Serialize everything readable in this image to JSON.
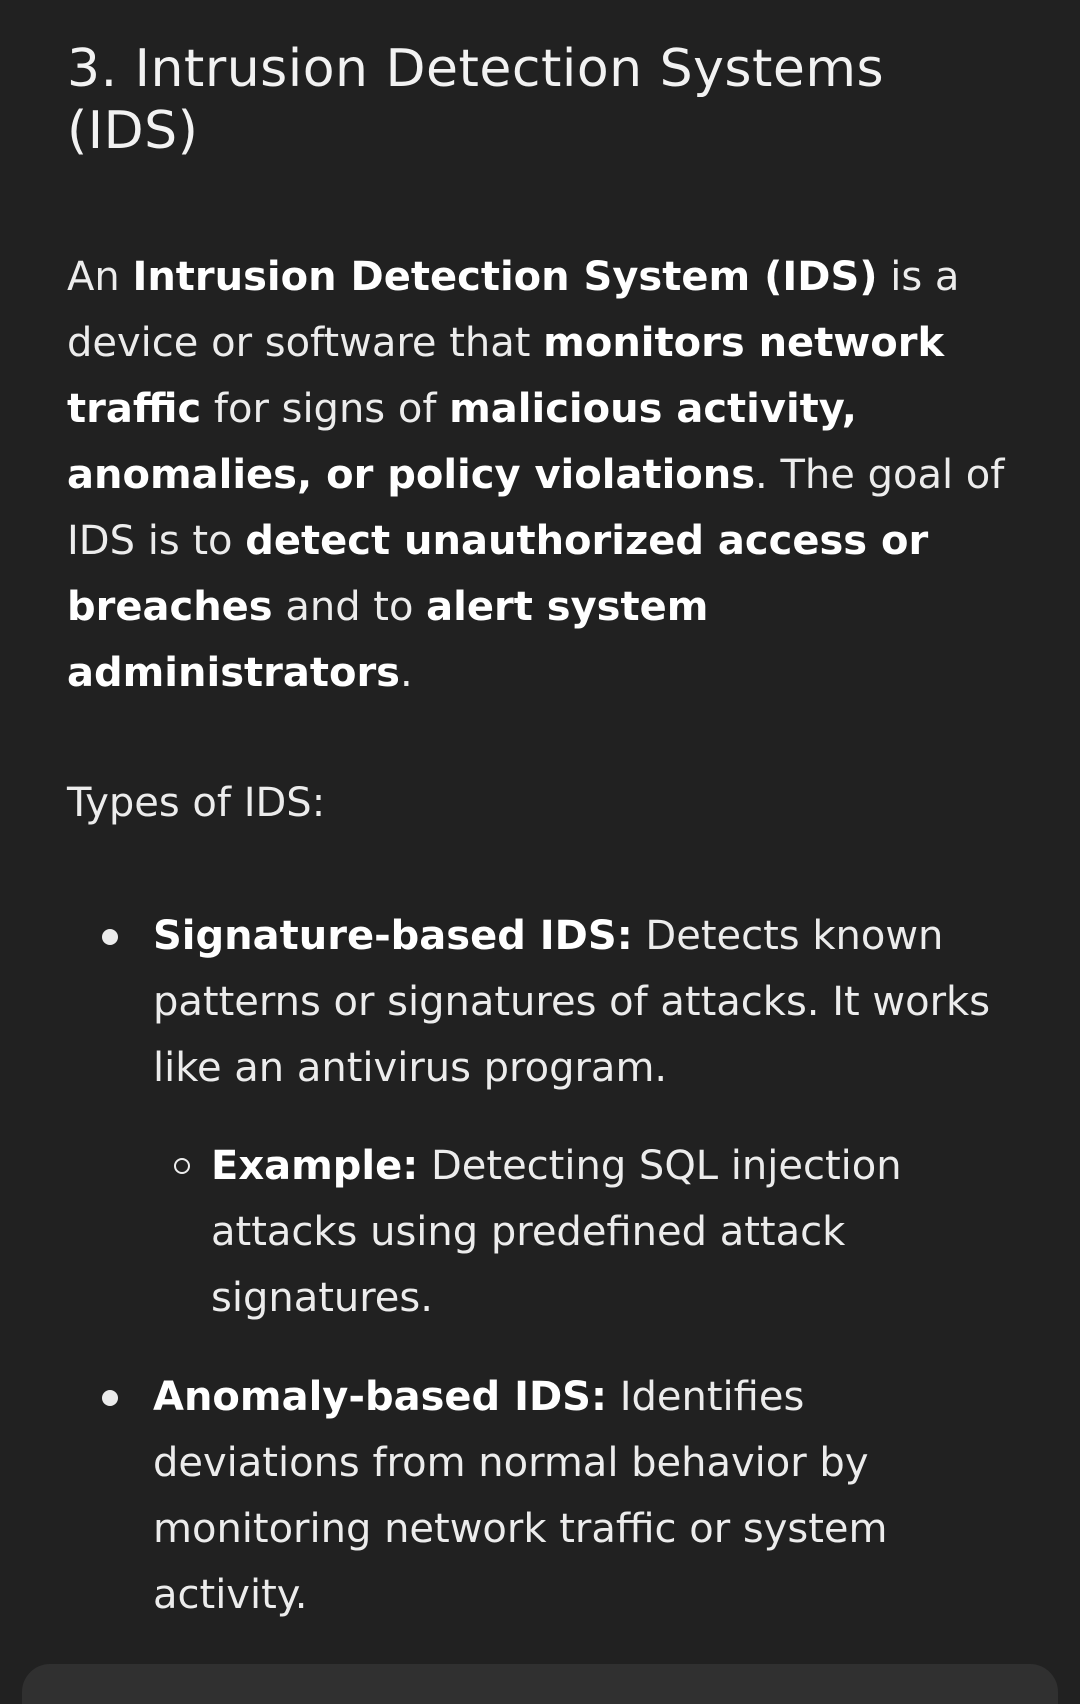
{
  "heading": "3. Intrusion Detection Systems (IDS)",
  "intro": {
    "p1": "An ",
    "b1": "Intrusion Detection System (IDS)",
    "p2": " is a device or software that ",
    "b2": "monitors network traffic",
    "p3": " for signs of ",
    "b3": "malicious activity, anomalies, or policy violations",
    "p4": ". The goal of IDS is to ",
    "b4": "detect unauthorized access or breaches",
    "p5": " and to ",
    "b5": "alert system administrators",
    "p6": "."
  },
  "types_heading": "Types of IDS:",
  "types": [
    {
      "title": "Signature-based IDS:",
      "text": " Detects known patterns or signatures of attacks. It works like an antivirus program.",
      "example_label": "Example:",
      "example_text": " Detecting SQL injection attacks using predefined attack signatures."
    },
    {
      "title": "Anomaly-based IDS:",
      "text": " Identifies deviations from normal behavior by monitoring network traffic or system activity."
    }
  ]
}
